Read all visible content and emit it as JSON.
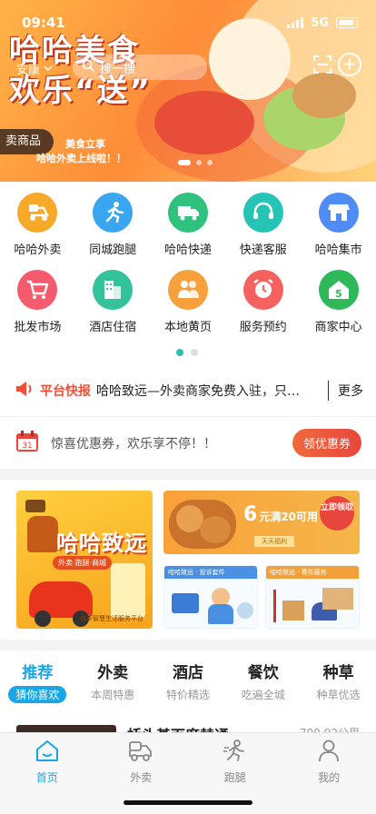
{
  "status_bar": {
    "time": "09:41",
    "network": "5G"
  },
  "banner": {
    "headline_line1": "哈哈美食",
    "headline_line2": "欢乐“送”",
    "city": "安康",
    "search_placeholder": "搜一搜",
    "category_tag": "卖商品",
    "promo_line1": "美食立享",
    "promo_line2": "哈哈外卖上线啦！！"
  },
  "grid": {
    "items": [
      {
        "label": "哈哈外卖",
        "icon": "scooter-icon",
        "color": "#f7a92a"
      },
      {
        "label": "同城跑腿",
        "icon": "runner-icon",
        "color": "#3aa6f0"
      },
      {
        "label": "哈哈快递",
        "icon": "truck-icon",
        "color": "#2ec27e"
      },
      {
        "label": "快递客服",
        "icon": "headset-icon",
        "color": "#25c4b4"
      },
      {
        "label": "哈哈集市",
        "icon": "shop-icon",
        "color": "#4f8df5"
      },
      {
        "label": "批发市场",
        "icon": "cart-icon",
        "color": "#f45b6c"
      },
      {
        "label": "酒店住宿",
        "icon": "building-icon",
        "color": "#33c29a"
      },
      {
        "label": "本地黄页",
        "icon": "people-icon",
        "color": "#f7a13c"
      },
      {
        "label": "服务预约",
        "icon": "alarm-icon",
        "color": "#f4615e"
      },
      {
        "label": "商家中心",
        "icon": "home-badge-icon",
        "color": "#2fb85a"
      }
    ]
  },
  "news": {
    "tag": "平台快报",
    "text": "哈哈致远—外卖商家免费入驻，只…",
    "more": "更多"
  },
  "coupon": {
    "text": "惊喜优惠券，欢乐享不停！！",
    "button": "领优惠券"
  },
  "ads": {
    "left_title": "哈哈致远",
    "left_sub": "外卖·跑腿·商城",
    "left_footer": "城乡智慧生活服务平台",
    "right_top_amount": "6",
    "right_top_text": "元满20可用",
    "right_top_cta": "立即领取",
    "right_top_strip": "天天福利",
    "right_b1_header": "哈哈致远 · 投诉套件",
    "right_b2_header": "哈哈致远 · 寄件服务"
  },
  "tabs": [
    {
      "label": "推荐",
      "sub": "猜你喜欢",
      "active": true
    },
    {
      "label": "外卖",
      "sub": "本周特惠"
    },
    {
      "label": "酒店",
      "sub": "特价精选"
    },
    {
      "label": "餐饮",
      "sub": "吃遍全城"
    },
    {
      "label": "种草",
      "sub": "种草优选"
    }
  ],
  "feed_peek": {
    "title": "桥头基面席替通",
    "distance": "700.92公里"
  },
  "nav": [
    {
      "label": "首页",
      "icon": "home-icon",
      "active": true
    },
    {
      "label": "外卖",
      "icon": "delivery-icon"
    },
    {
      "label": "跑腿",
      "icon": "errand-icon"
    },
    {
      "label": "我的",
      "icon": "user-icon"
    }
  ],
  "colors": {
    "accent": "#1aa6e6",
    "brand_orange": "#ff8c38",
    "alert_red": "#f0503a"
  }
}
